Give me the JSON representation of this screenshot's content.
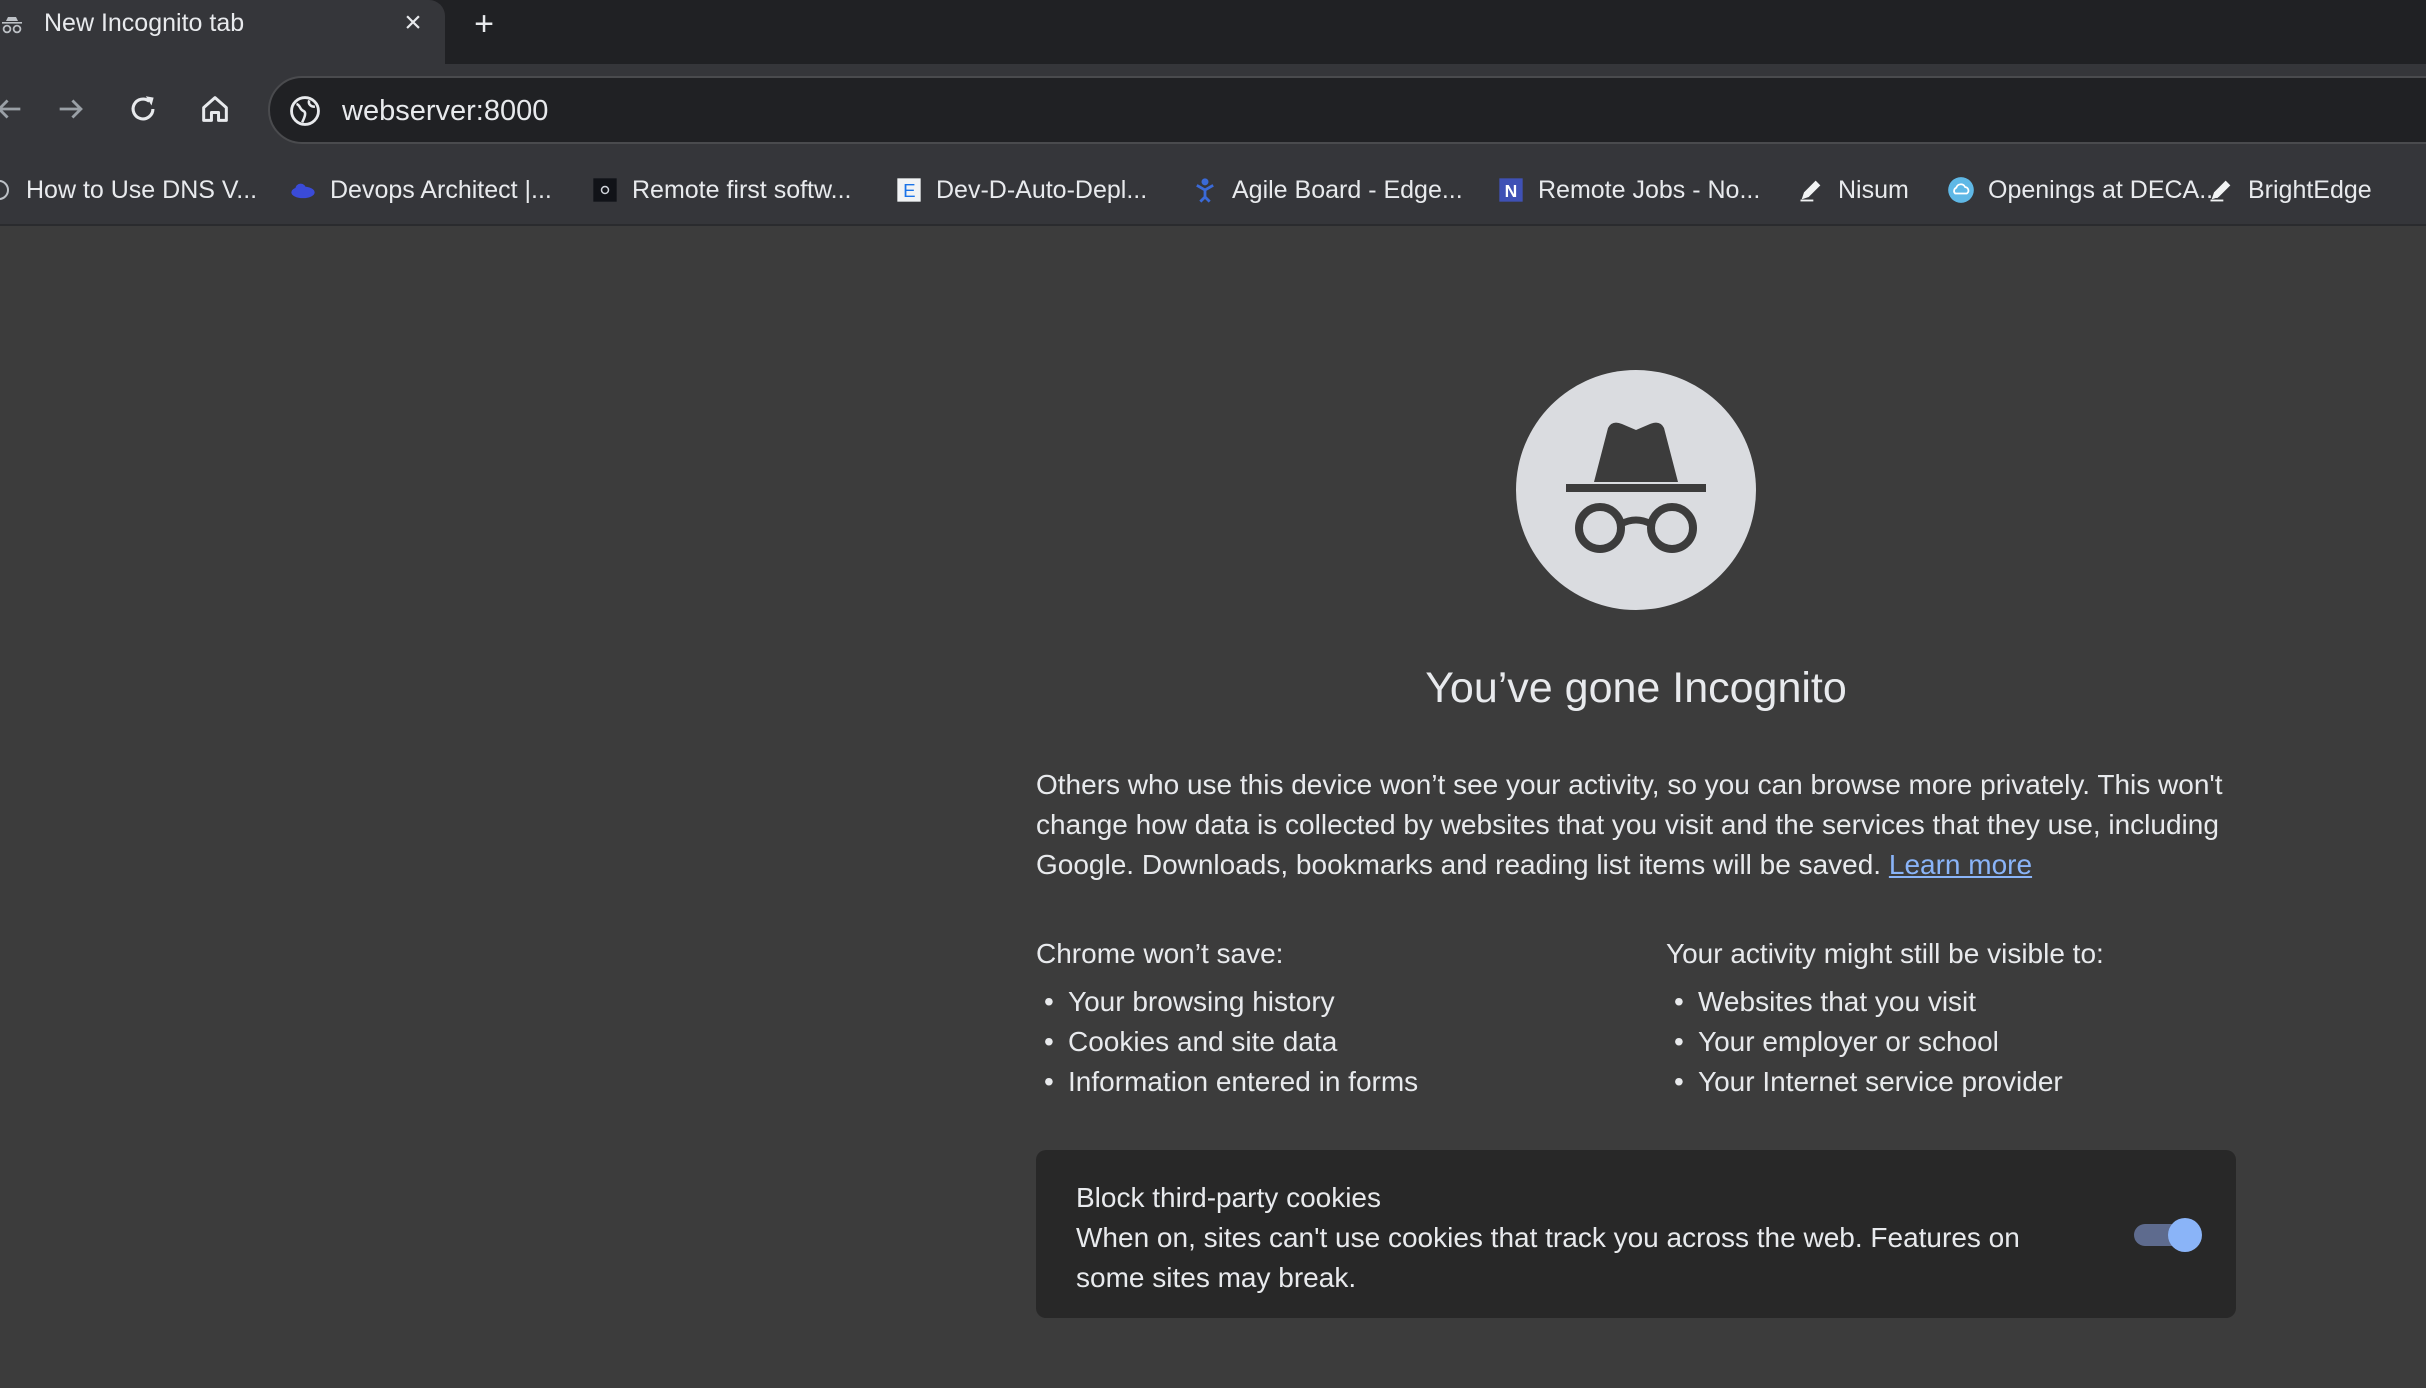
{
  "tab": {
    "title": "New Incognito tab",
    "icon": "incognito-icon",
    "close_symbol": "×",
    "new_tab_symbol": "+"
  },
  "toolbar": {
    "address": "webserver:8000",
    "address_icon": "globe-icon"
  },
  "bookmarks": [
    {
      "label": "How to Use DNS V...",
      "icon": "globe-icon"
    },
    {
      "label": "Devops Architect |...",
      "icon": "cloud-icon"
    },
    {
      "label": "Remote first softw...",
      "icon": "dark-square-icon"
    },
    {
      "label": "Dev-D-Auto-Depl...",
      "icon": "document-e-icon"
    },
    {
      "label": "Agile Board - Edge...",
      "icon": "agile-icon"
    },
    {
      "label": "Remote Jobs - No...",
      "icon": "n-letter-icon"
    },
    {
      "label": "Nisum",
      "icon": "pen-icon"
    },
    {
      "label": "Openings at DECA...",
      "icon": "cloud-circle-icon"
    },
    {
      "label": "BrightEdge",
      "icon": "pen-icon"
    }
  ],
  "page": {
    "headline": "You’ve gone Incognito",
    "intro": "Others who use this device won’t see your activity, so you can browse more privately. This won't change how data is collected by websites that you visit and the services that they use, including Google. Downloads, bookmarks and reading list items will be saved.",
    "learn_more": "Learn more",
    "wont_save": {
      "title": "Chrome won’t save:",
      "items": [
        "Your browsing history",
        "Cookies and site data",
        "Information entered in forms"
      ]
    },
    "visible_to": {
      "title": "Your activity might still be visible to:",
      "items": [
        "Websites that you visit",
        "Your employer or school",
        "Your Internet service provider"
      ]
    },
    "cookies": {
      "title": "Block third-party cookies",
      "description": "When on, sites can't use cookies that track you across the web. Features on some sites may break.",
      "enabled": true
    }
  },
  "colors": {
    "tabstrip_bg": "#202124",
    "toolbar_bg": "#35363a",
    "page_bg": "#3c3c3c",
    "link": "#8ab4f8",
    "toggle_on": "#8ab4f8"
  }
}
